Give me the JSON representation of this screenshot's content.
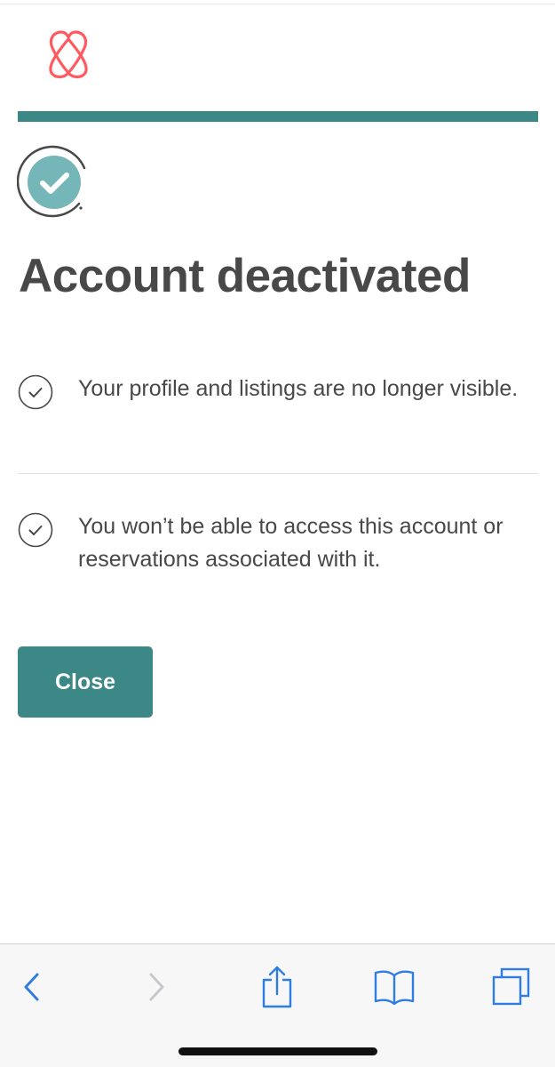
{
  "app": {
    "logo_icon": "airbnb-belo-icon",
    "brand_color": "#ff5a5f",
    "accent_color": "#3b8886",
    "progress": 1.0
  },
  "header": {
    "title": "Account deactivated",
    "status_icon": "check-circle-icon"
  },
  "notices": [
    {
      "icon": "check-outline-icon",
      "text": "Your profile and listings are no longer visible."
    },
    {
      "icon": "check-outline-icon",
      "text": "You won’t be able to access this account or reservations associated with it."
    }
  ],
  "actions": {
    "close_label": "Close"
  },
  "browser_toolbar": {
    "icons": [
      "back-arrow-icon",
      "forward-arrow-icon",
      "share-icon",
      "bookmarks-icon",
      "tabs-icon"
    ],
    "forward_enabled": false
  }
}
